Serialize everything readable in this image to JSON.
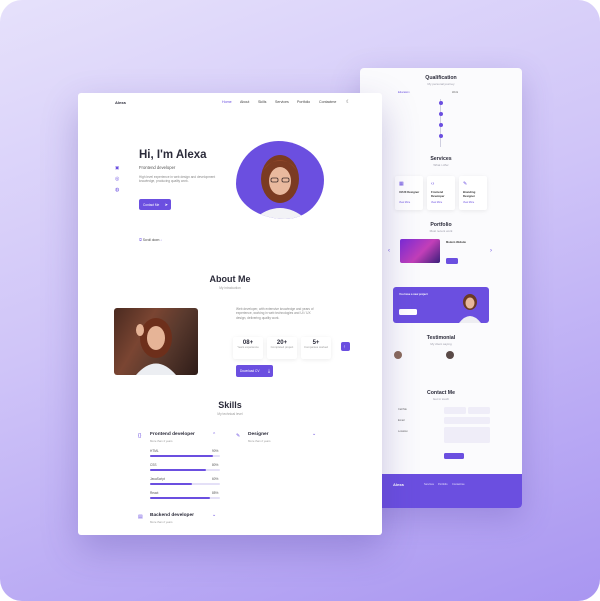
{
  "brand": {
    "accent": "#6b4fe0",
    "background": "#cfc4f8"
  },
  "front": {
    "nav": {
      "logo": "Alexa",
      "items": [
        {
          "label": "Home",
          "active": true
        },
        {
          "label": "About",
          "active": false
        },
        {
          "label": "Skills",
          "active": false
        },
        {
          "label": "Services",
          "active": false
        },
        {
          "label": "Portfolio",
          "active": false
        },
        {
          "label": "Contactme",
          "active": false
        }
      ],
      "theme_toggle_icon": "moon-icon"
    },
    "social_icons": [
      "linkedin-icon",
      "dribbble-icon",
      "github-icon"
    ],
    "hero": {
      "title": "Hi, I'm Alexa",
      "subtitle": "Frontend developer",
      "description": "High level experience in web design and development knowledge, producing quality work.",
      "button": "Contact Me"
    },
    "scroll_hint": "Scroll down",
    "about": {
      "title": "About Me",
      "subtitle": "My introduction",
      "description": "Web developer, with extensive knowledge and years of experience, working in web technologies and UI / UX design, delivering quality work.",
      "stats": [
        {
          "value": "08+",
          "label": "Years experience"
        },
        {
          "value": "20+",
          "label": "Completed project"
        },
        {
          "value": "5+",
          "label": "Companies worked"
        }
      ],
      "button": "Download CV"
    },
    "skills": {
      "title": "Skills",
      "subtitle": "My technical level",
      "groups": [
        {
          "name": "Frontend developer",
          "meta": "More than 4 years",
          "items": [
            {
              "name": "HTML",
              "percent": 90
            },
            {
              "name": "CSS",
              "percent": 80
            },
            {
              "name": "JavaScript",
              "percent": 60
            },
            {
              "name": "React",
              "percent": 85
            }
          ]
        },
        {
          "name": "Designer",
          "meta": "More than 2 years"
        },
        {
          "name": "Backend developer",
          "meta": "More than 2 years"
        }
      ]
    }
  },
  "back": {
    "qualification": {
      "title": "Qualification",
      "subtitle": "My personal journey",
      "tabs": [
        "Education",
        "Work"
      ]
    },
    "services": {
      "title": "Services",
      "subtitle": "What i offer",
      "items": [
        {
          "name": "UI/UX Designer",
          "link": "View More"
        },
        {
          "name": "Frontend Developer",
          "link": "View More"
        },
        {
          "name": "Branding Designer",
          "link": "View More"
        }
      ]
    },
    "portfolio": {
      "title": "Portfolio",
      "subtitle": "Most recent work",
      "project_title": "Modern Website",
      "button": "Demo"
    },
    "cta": {
      "title": "You have a new project",
      "button": "Contact Me"
    },
    "testimonial": {
      "title": "Testimonial",
      "subtitle": "My client saying"
    },
    "contact": {
      "title": "Contact Me",
      "subtitle": "Get in touch",
      "info": [
        "Call Me",
        "Email",
        "Location"
      ],
      "button": "Send Message"
    },
    "footer": {
      "logo": "Alexa",
      "links": [
        "Services",
        "Portfolio",
        "Contactme"
      ]
    }
  }
}
